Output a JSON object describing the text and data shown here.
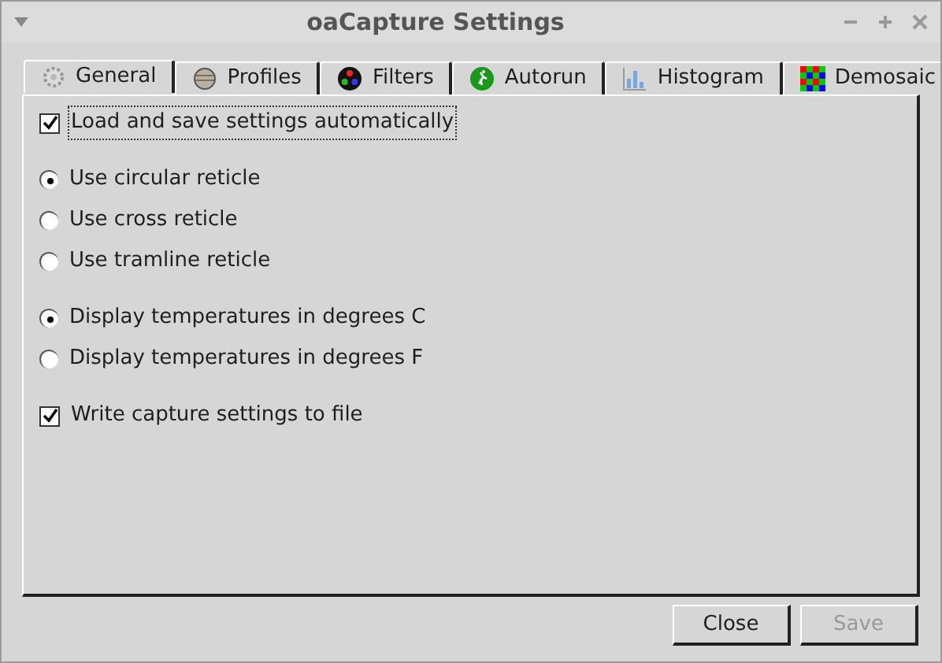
{
  "window": {
    "title": "oaCapture Settings"
  },
  "tabs": [
    {
      "label": "General",
      "selected": true
    },
    {
      "label": "Profiles",
      "selected": false
    },
    {
      "label": "Filters",
      "selected": false
    },
    {
      "label": "Autorun",
      "selected": false
    },
    {
      "label": "Histogram",
      "selected": false
    },
    {
      "label": "Demosaic",
      "selected": false
    }
  ],
  "groups": [
    {
      "options": [
        {
          "kind": "checkbox",
          "label": "Load and save settings automatically",
          "checked": true,
          "focused": true
        }
      ]
    },
    {
      "options": [
        {
          "kind": "radio",
          "label": "Use circular reticle",
          "checked": true,
          "focused": false
        },
        {
          "kind": "radio",
          "label": "Use cross reticle",
          "checked": false,
          "focused": false
        },
        {
          "kind": "radio",
          "label": "Use tramline reticle",
          "checked": false,
          "focused": false
        }
      ]
    },
    {
      "options": [
        {
          "kind": "radio",
          "label": "Display temperatures in degrees C",
          "checked": true,
          "focused": false
        },
        {
          "kind": "radio",
          "label": "Display temperatures in degrees F",
          "checked": false,
          "focused": false
        }
      ]
    },
    {
      "options": [
        {
          "kind": "checkbox",
          "label": "Write capture settings to file",
          "checked": true,
          "focused": false
        }
      ]
    }
  ],
  "buttons": [
    {
      "label": "Close",
      "disabled": false
    },
    {
      "label": "Save",
      "disabled": true
    }
  ]
}
